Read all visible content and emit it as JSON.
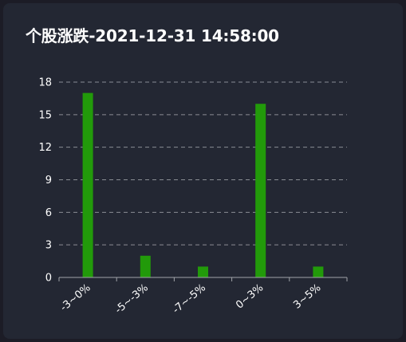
{
  "title": "个股涨跌-2021-12-31 14:58:00",
  "colors": {
    "background": "#232733",
    "bar": "#229a0a",
    "text": "#ffffff",
    "grid": "#8a8d94",
    "axis": "#a0a3a8"
  },
  "chart_data": {
    "type": "bar",
    "title": "个股涨跌-2021-12-31 14:58:00",
    "categories": [
      "-3~0%",
      "-5~-3%",
      "-7~-5%",
      "0~3%",
      "3~5%"
    ],
    "values": [
      17,
      2,
      1,
      16,
      1
    ],
    "yticks": [
      0,
      3,
      6,
      9,
      12,
      15,
      18
    ],
    "ylim": [
      0,
      18
    ],
    "grid": "dashed-horizontal",
    "legend": "none",
    "xtick_rotation": -40
  }
}
